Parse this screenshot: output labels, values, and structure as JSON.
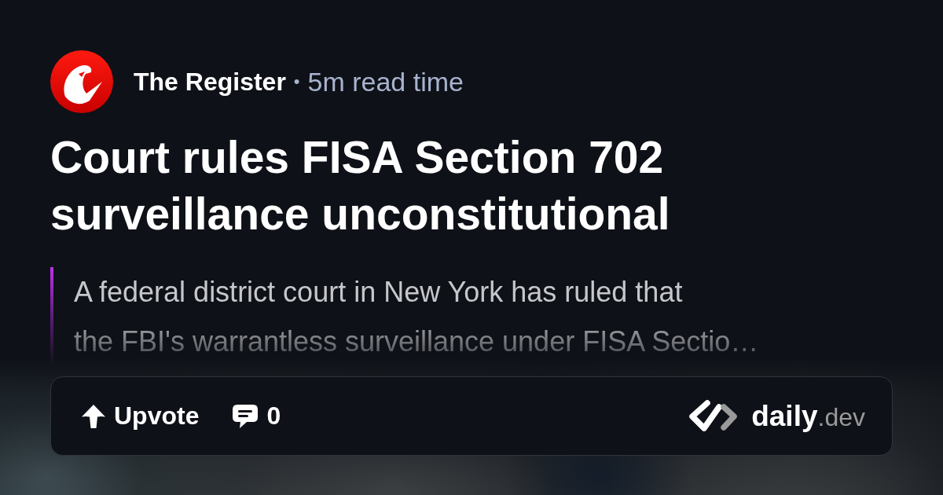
{
  "source": {
    "name": "The Register",
    "separator": "•",
    "read_time": "5m read time"
  },
  "title": "Court rules FISA Section 702 surveillance unconstitutional",
  "description": {
    "lines": [
      "A federal district court in New York has ruled that",
      "the FBI's warrantless surveillance under FISA Sectio…"
    ]
  },
  "actions": [
    {
      "kind": "upvote",
      "label": "Upvote"
    },
    {
      "kind": "comments",
      "label": "0"
    }
  ],
  "brand": "**daily**.dev"
}
